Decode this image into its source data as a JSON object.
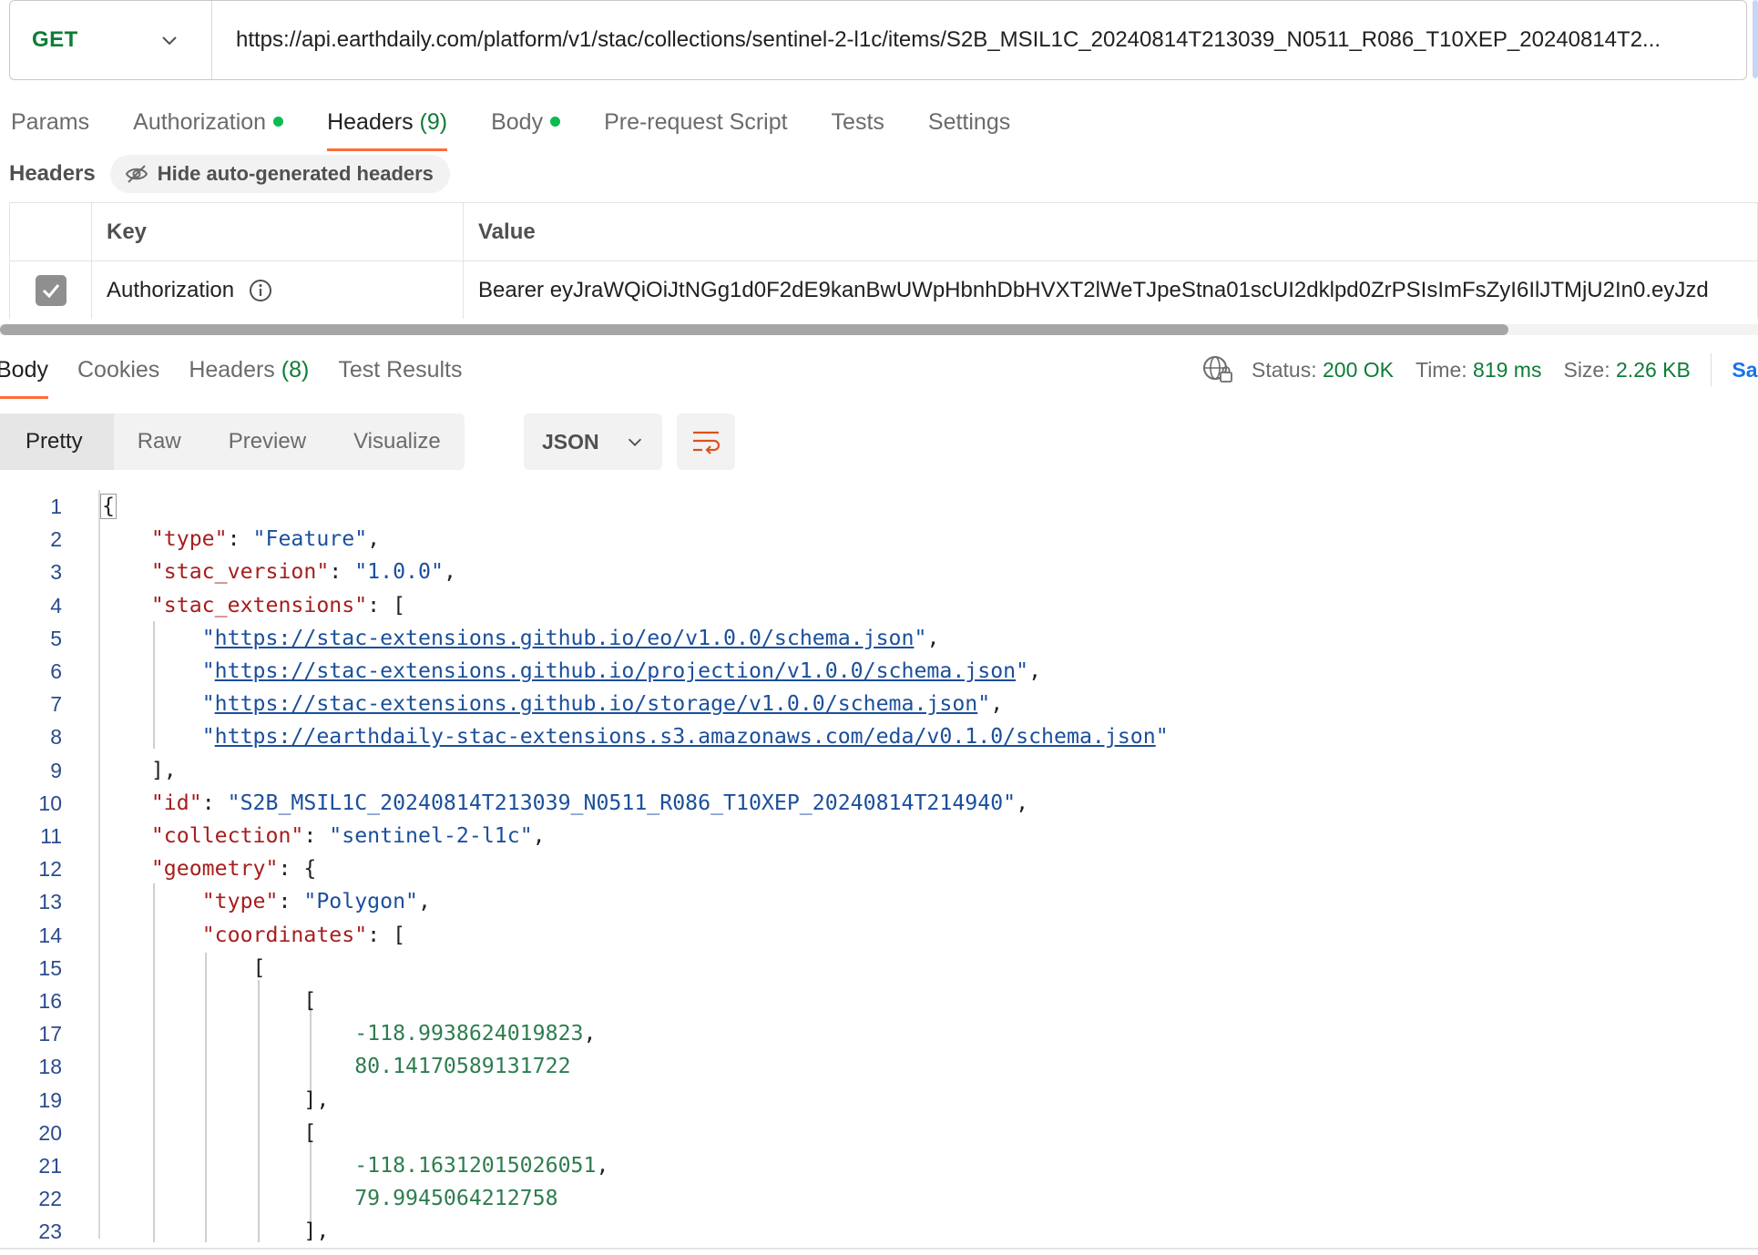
{
  "request": {
    "method": "GET",
    "url": "https://api.earthdaily.com/platform/v1/stac/collections/sentinel-2-l1c/items/S2B_MSIL1C_20240814T213039_N0511_R086_T10XEP_20240814T2..."
  },
  "request_tabs": [
    {
      "label": "Params"
    },
    {
      "label": "Authorization"
    },
    {
      "label": "Headers",
      "count": "(9)"
    },
    {
      "label": "Body"
    },
    {
      "label": "Pre-request Script"
    },
    {
      "label": "Tests"
    },
    {
      "label": "Settings"
    }
  ],
  "headers_section": {
    "title": "Headers",
    "hide_button": "Hide auto-generated headers",
    "columns": {
      "key": "Key",
      "value": "Value"
    },
    "rows": [
      {
        "checked": true,
        "key": "Authorization",
        "value": "Bearer eyJraWQiOiJtNGg1d0F2dE9kanBwUWpHbnhDbHVXT2lWeTJpeStna01scUI2dklpd0ZrPSIsImFsZyI6IlJTMjU2In0.eyJzd"
      }
    ]
  },
  "response_tabs": [
    {
      "label": "Body"
    },
    {
      "label": "Cookies"
    },
    {
      "label": "Headers",
      "count": "(8)"
    },
    {
      "label": "Test Results"
    }
  ],
  "status": {
    "status_label": "Status:",
    "status_value": "200 OK",
    "time_label": "Time:",
    "time_value": "819 ms",
    "size_label": "Size:",
    "size_value": "2.26 KB",
    "save_truncated": "Sa"
  },
  "view": {
    "modes": [
      "Pretty",
      "Raw",
      "Preview",
      "Visualize"
    ],
    "format": "JSON"
  },
  "colors": {
    "accent": "#ff6c37",
    "status_green": "#0e7c37",
    "json_key": "#a61e1e",
    "json_string": "#1b4f9c",
    "json_number": "#2e7d4f"
  },
  "code_lines": [
    {
      "n": "1",
      "segs": [
        {
          "t": "{",
          "c": "brace"
        }
      ]
    },
    {
      "n": "2",
      "segs": [
        {
          "t": "    "
        },
        {
          "t": "\"type\"",
          "c": "k"
        },
        {
          "t": ": "
        },
        {
          "t": "\"Feature\"",
          "c": "s"
        },
        {
          "t": ","
        }
      ]
    },
    {
      "n": "3",
      "segs": [
        {
          "t": "    "
        },
        {
          "t": "\"stac_version\"",
          "c": "k"
        },
        {
          "t": ": "
        },
        {
          "t": "\"1.0.0\"",
          "c": "s"
        },
        {
          "t": ","
        }
      ]
    },
    {
      "n": "4",
      "segs": [
        {
          "t": "    "
        },
        {
          "t": "\"stac_extensions\"",
          "c": "k"
        },
        {
          "t": ": ["
        }
      ]
    },
    {
      "n": "5",
      "segs": [
        {
          "t": "        "
        },
        {
          "t": "\"",
          "c": "s"
        },
        {
          "t": "https://stac-extensions.github.io/eo/v1.0.0/schema.json",
          "c": "u"
        },
        {
          "t": "\"",
          "c": "s"
        },
        {
          "t": ","
        }
      ]
    },
    {
      "n": "6",
      "segs": [
        {
          "t": "        "
        },
        {
          "t": "\"",
          "c": "s"
        },
        {
          "t": "https://stac-extensions.github.io/projection/v1.0.0/schema.json",
          "c": "u"
        },
        {
          "t": "\"",
          "c": "s"
        },
        {
          "t": ","
        }
      ]
    },
    {
      "n": "7",
      "segs": [
        {
          "t": "        "
        },
        {
          "t": "\"",
          "c": "s"
        },
        {
          "t": "https://stac-extensions.github.io/storage/v1.0.0/schema.json",
          "c": "u"
        },
        {
          "t": "\"",
          "c": "s"
        },
        {
          "t": ","
        }
      ]
    },
    {
      "n": "8",
      "segs": [
        {
          "t": "        "
        },
        {
          "t": "\"",
          "c": "s"
        },
        {
          "t": "https://earthdaily-stac-extensions.s3.amazonaws.com/eda/v0.1.0/schema.json",
          "c": "u"
        },
        {
          "t": "\"",
          "c": "s"
        }
      ]
    },
    {
      "n": "9",
      "segs": [
        {
          "t": "    ],"
        }
      ]
    },
    {
      "n": "10",
      "segs": [
        {
          "t": "    "
        },
        {
          "t": "\"id\"",
          "c": "k"
        },
        {
          "t": ": "
        },
        {
          "t": "\"S2B_MSIL1C_20240814T213039_N0511_R086_T10XEP_20240814T214940\"",
          "c": "s"
        },
        {
          "t": ","
        }
      ]
    },
    {
      "n": "11",
      "segs": [
        {
          "t": "    "
        },
        {
          "t": "\"collection\"",
          "c": "k"
        },
        {
          "t": ": "
        },
        {
          "t": "\"sentinel-2-l1c\"",
          "c": "s"
        },
        {
          "t": ","
        }
      ]
    },
    {
      "n": "12",
      "segs": [
        {
          "t": "    "
        },
        {
          "t": "\"geometry\"",
          "c": "k"
        },
        {
          "t": ": {"
        }
      ]
    },
    {
      "n": "13",
      "segs": [
        {
          "t": "        "
        },
        {
          "t": "\"type\"",
          "c": "k"
        },
        {
          "t": ": "
        },
        {
          "t": "\"Polygon\"",
          "c": "s"
        },
        {
          "t": ","
        }
      ]
    },
    {
      "n": "14",
      "segs": [
        {
          "t": "        "
        },
        {
          "t": "\"coordinates\"",
          "c": "k"
        },
        {
          "t": ": ["
        }
      ]
    },
    {
      "n": "15",
      "segs": [
        {
          "t": "            ["
        }
      ]
    },
    {
      "n": "16",
      "segs": [
        {
          "t": "                ["
        }
      ]
    },
    {
      "n": "17",
      "segs": [
        {
          "t": "                    "
        },
        {
          "t": "-118.9938624019823",
          "c": "n"
        },
        {
          "t": ","
        }
      ]
    },
    {
      "n": "18",
      "segs": [
        {
          "t": "                    "
        },
        {
          "t": "80.14170589131722",
          "c": "n"
        }
      ]
    },
    {
      "n": "19",
      "segs": [
        {
          "t": "                ],"
        }
      ]
    },
    {
      "n": "20",
      "segs": [
        {
          "t": "                ["
        }
      ]
    },
    {
      "n": "21",
      "segs": [
        {
          "t": "                    "
        },
        {
          "t": "-118.16312015026051",
          "c": "n"
        },
        {
          "t": ","
        }
      ]
    },
    {
      "n": "22",
      "segs": [
        {
          "t": "                    "
        },
        {
          "t": "79.9945064212758",
          "c": "n"
        }
      ]
    },
    {
      "n": "23",
      "segs": [
        {
          "t": "                ],"
        }
      ]
    }
  ]
}
